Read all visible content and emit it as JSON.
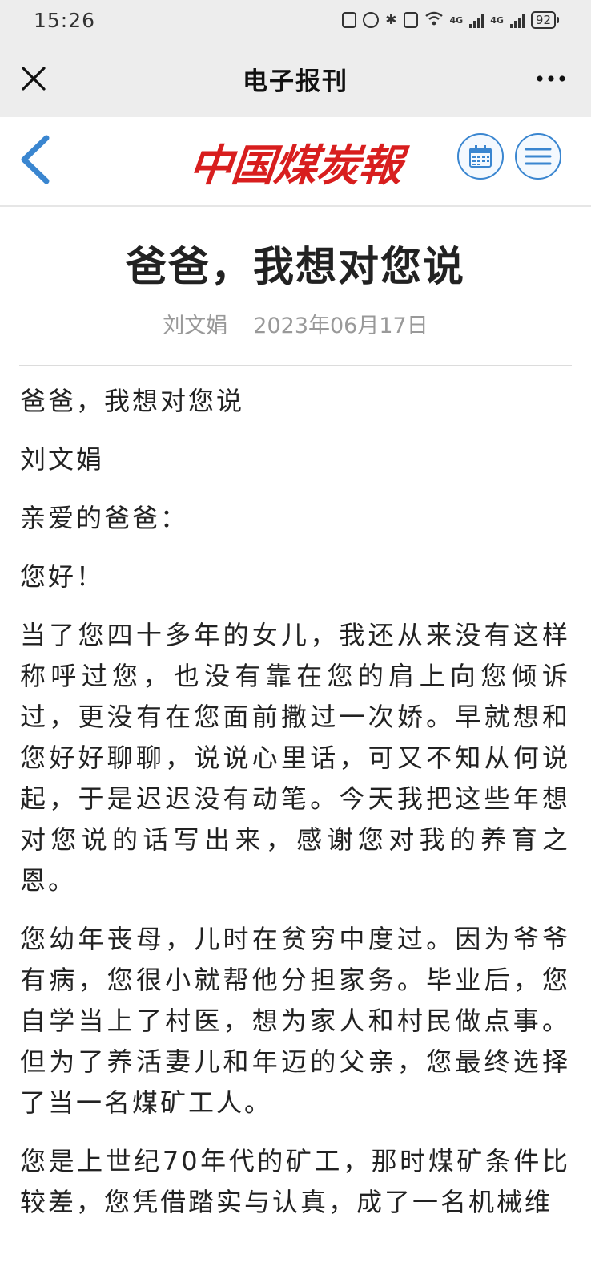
{
  "status_bar": {
    "time": "15:26",
    "signal_label_1": "4G",
    "signal_label_2": "4G",
    "battery": "92"
  },
  "wechat_bar": {
    "title": "电子报刊",
    "close_icon": "close-icon",
    "more_icon": "more-icon"
  },
  "header": {
    "masthead": "中国煤炭報",
    "brand_color": "#d81e1e",
    "accent_color": "#3a86d0",
    "back_icon": "chevron-left-icon",
    "calendar_icon": "calendar-icon",
    "menu_icon": "menu-icon"
  },
  "article": {
    "title": "爸爸，我想对您说",
    "author": "刘文娟",
    "date": "2023年06月17日",
    "paragraphs": [
      "爸爸，我想对您说",
      "刘文娟",
      "亲爱的爸爸：",
      "您好！",
      "当了您四十多年的女儿，我还从来没有这样称呼过您，也没有靠在您的肩上向您倾诉过，更没有在您面前撒过一次娇。早就想和您好好聊聊，说说心里话，可又不知从何说起，于是迟迟没有动笔。今天我把这些年想对您说的话写出来，感谢您对我的养育之恩。",
      "您幼年丧母，儿时在贫穷中度过。因为爷爷有病，您很小就帮他分担家务。毕业后，您自学当上了村医，想为家人和村民做点事。但为了养活妻儿和年迈的父亲，您最终选择了当一名煤矿工人。",
      "您是上世纪70年代的矿工，那时煤矿条件比较差，您凭借踏实与认真，成了一名机械维"
    ]
  }
}
